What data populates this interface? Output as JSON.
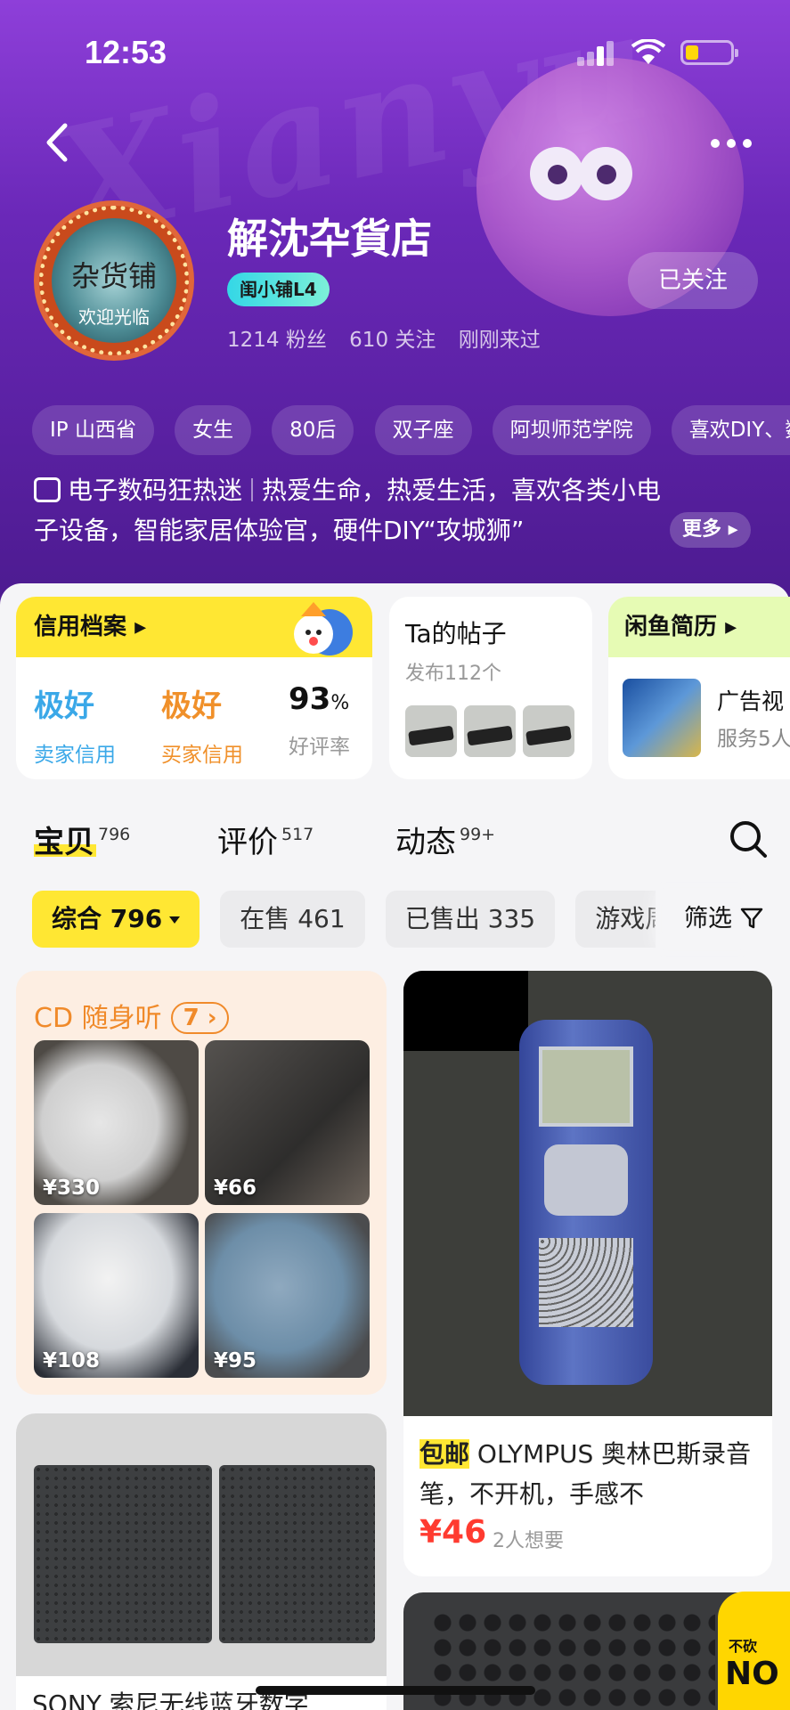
{
  "status_bar": {
    "time": "12:53"
  },
  "shop": {
    "name": "解沈卆貨店",
    "level": "闺小铺L4",
    "fans": "1214 粉丝",
    "following": "610 关注",
    "last_seen": "刚刚来过",
    "follow_label": "已关注",
    "avatar_text_top": "杂货铺",
    "avatar_text_bottom": "欢迎光临"
  },
  "tags": [
    "IP 山西省",
    "女生",
    "80后",
    "双子座",
    "阿坝师范学院",
    "喜欢DIY、数"
  ],
  "bio": {
    "category": "电子数码狂热迷",
    "text_line1": "热爱生命，热爱生活，喜欢各类小电",
    "text_line2": "子设备，智能家居体验官，硬件DIY“攻城狮”",
    "more_label": "更多"
  },
  "credit": {
    "title": "信用档案",
    "seller_value": "极好",
    "seller_label": "卖家信用",
    "buyer_value": "极好",
    "buyer_label": "买家信用",
    "rate_value": "93",
    "rate_unit": "%",
    "rate_label": "好评率",
    "colors": {
      "seller": "#3aa8e8",
      "buyer": "#f0902a"
    }
  },
  "posts": {
    "title": "Ta的帖子",
    "subtitle": "发布112个"
  },
  "resume": {
    "title": "闲鱼简历",
    "item_title": "广告视",
    "item_sub": "服务5人"
  },
  "tabs": [
    {
      "label": "宝贝",
      "count": "796"
    },
    {
      "label": "评价",
      "count": "517"
    },
    {
      "label": "动态",
      "count": "99+"
    }
  ],
  "chips": [
    {
      "label": "综合 796"
    },
    {
      "label": "在售 461"
    },
    {
      "label": "已售出 335"
    },
    {
      "label": "游戏周"
    }
  ],
  "filter_label": "筛选",
  "cd_section": {
    "title": "CD 随身听",
    "count": "7",
    "items": [
      {
        "price": "¥330"
      },
      {
        "price": "¥66"
      },
      {
        "price": "¥108"
      },
      {
        "price": "¥95"
      }
    ]
  },
  "olympus_item": {
    "badge": "包邮",
    "title": " OLYMPUS 奥林巴斯录音笔，不开机，手感不",
    "price": "¥46",
    "wants": "2人想要"
  },
  "sony_item": {
    "title": "SONY 索尼无线蓝牙数字"
  },
  "sticker": {
    "top": "不砍",
    "big": "NO"
  },
  "colors": {
    "accent_yellow": "#ffe733",
    "price_red": "#ff3b30",
    "header_purple": "#6a28b8"
  }
}
